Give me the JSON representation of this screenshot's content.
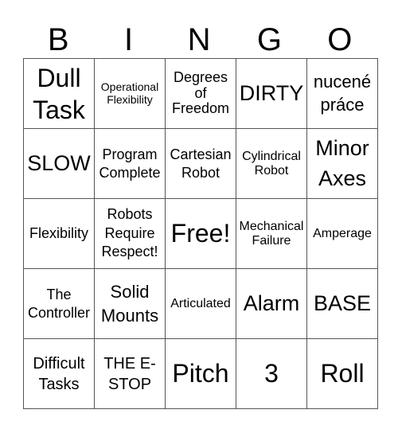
{
  "title_letters": [
    "B",
    "I",
    "N",
    "G",
    "O"
  ],
  "rows": [
    [
      "Dull Task",
      "Operational Flexibility",
      "Degrees of Freedom",
      "DIRTY",
      "nucené práce"
    ],
    [
      "SLOW",
      "Program Complete",
      "Cartesian Robot",
      "Cylindrical Robot",
      "Minor Axes"
    ],
    [
      "Flexibility",
      "Robots Require Respect!",
      "Free!",
      "Mechanical Failure",
      "Amperage"
    ],
    [
      "The Controller",
      "Solid Mounts",
      "Articulated",
      "Alarm",
      "BASE"
    ],
    [
      "Difficult Tasks",
      "THE E-STOP",
      "Pitch",
      "3",
      "Roll"
    ]
  ]
}
